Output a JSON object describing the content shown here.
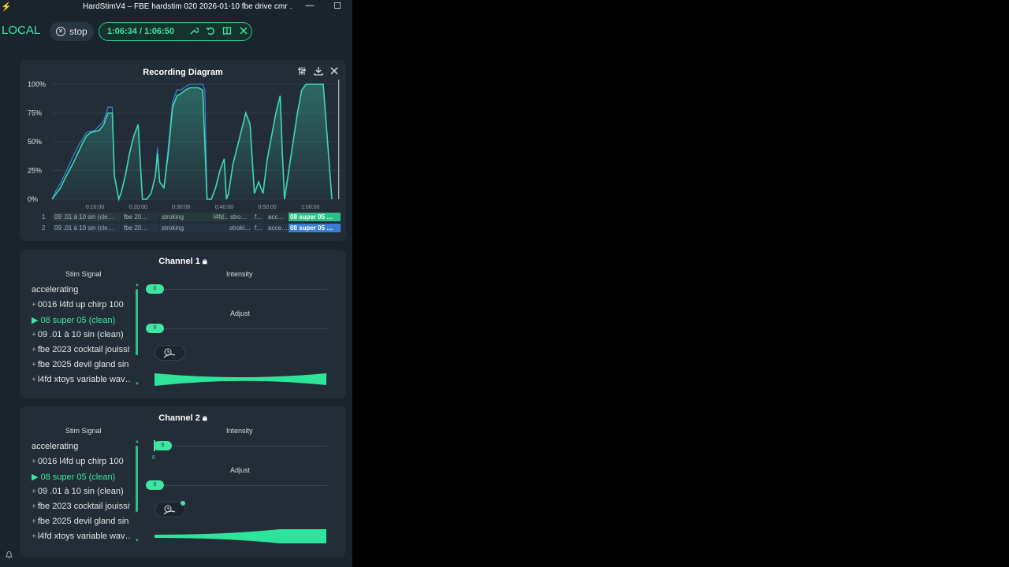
{
  "window": {
    "title": "HardStimV4 – FBE hardstim 020 2026-01-10 fbe drive cmr …",
    "minimize": "—",
    "maximize": "☐"
  },
  "topbar": {
    "mode": "LOCAL",
    "stop_label": "stop",
    "time": "1:06:34 / 1:06:50"
  },
  "diagram": {
    "title": "Recording Diagram",
    "tracks": [
      {
        "num": "1",
        "segments": [
          "09 .01 à 10  sin (cle…",
          "fbe 20…",
          "stroking",
          "l4fd…",
          "stro…",
          "f…",
          "acc…",
          "08  super  05 …"
        ]
      },
      {
        "num": "2",
        "segments": [
          "09 .01 à 10  sin (cle…",
          "fbe 20…",
          "stroking",
          "stroki…",
          "f…",
          "acce…",
          "08  super  05 …"
        ]
      }
    ]
  },
  "chart_data": {
    "type": "line",
    "title": "Recording Diagram",
    "xlabel": "",
    "ylabel": "",
    "y_ticks": [
      "100%",
      "75%",
      "50%",
      "25%",
      "0%"
    ],
    "x_ticks": [
      "0:10:00",
      "0:20:00",
      "0:30:00",
      "0:40:00",
      "0:50:00",
      "1:00:00"
    ],
    "xlim_minutes": [
      0,
      66.83
    ],
    "ylim_percent": [
      0,
      100
    ],
    "grid": true,
    "series": [
      {
        "color": "#3fd6b4",
        "points": [
          [
            0,
            0
          ],
          [
            1,
            5
          ],
          [
            2,
            10
          ],
          [
            3,
            18
          ],
          [
            4,
            25
          ],
          [
            5,
            32
          ],
          [
            6,
            40
          ],
          [
            7,
            48
          ],
          [
            8,
            55
          ],
          [
            9,
            58
          ],
          [
            11,
            60
          ],
          [
            12,
            65
          ],
          [
            13,
            75
          ],
          [
            14,
            75
          ],
          [
            14.5,
            20
          ],
          [
            15.5,
            0
          ],
          [
            16,
            5
          ],
          [
            17,
            20
          ],
          [
            18,
            40
          ],
          [
            19,
            55
          ],
          [
            20,
            65
          ],
          [
            21,
            0
          ],
          [
            22,
            0
          ],
          [
            23,
            5
          ],
          [
            24,
            20
          ],
          [
            24.5,
            40
          ],
          [
            25,
            15
          ],
          [
            26,
            10
          ],
          [
            27,
            40
          ],
          [
            28,
            80
          ],
          [
            29,
            90
          ],
          [
            30,
            92
          ],
          [
            31,
            95
          ],
          [
            32,
            97
          ],
          [
            34,
            97
          ],
          [
            35,
            95
          ],
          [
            36,
            0
          ],
          [
            37,
            0
          ],
          [
            38,
            10
          ],
          [
            39,
            25
          ],
          [
            40,
            35
          ],
          [
            40.5,
            0
          ],
          [
            41,
            5
          ],
          [
            42,
            30
          ],
          [
            43,
            45
          ],
          [
            44,
            60
          ],
          [
            45,
            75
          ],
          [
            46,
            65
          ],
          [
            47,
            5
          ],
          [
            48,
            15
          ],
          [
            49,
            5
          ],
          [
            50,
            35
          ],
          [
            51,
            55
          ],
          [
            52,
            75
          ],
          [
            53,
            90
          ],
          [
            53.5,
            40
          ],
          [
            54,
            0
          ],
          [
            55,
            25
          ],
          [
            56,
            50
          ],
          [
            57,
            75
          ],
          [
            58,
            95
          ],
          [
            59,
            100
          ],
          [
            63,
            100
          ],
          [
            64,
            50
          ],
          [
            65,
            0
          ]
        ]
      },
      {
        "color": "#3a7fd0",
        "points": [
          [
            0,
            0
          ],
          [
            1,
            8
          ],
          [
            2,
            14
          ],
          [
            3,
            22
          ],
          [
            4,
            30
          ],
          [
            5,
            38
          ],
          [
            6,
            46
          ],
          [
            7,
            52
          ],
          [
            8,
            58
          ],
          [
            10,
            60
          ],
          [
            12,
            68
          ],
          [
            13,
            80
          ],
          [
            14,
            80
          ],
          [
            14.5,
            20
          ],
          [
            15.5,
            0
          ],
          [
            16,
            5
          ],
          [
            17,
            20
          ],
          [
            18,
            40
          ],
          [
            19,
            55
          ],
          [
            20,
            65
          ],
          [
            21,
            0
          ],
          [
            22,
            0
          ],
          [
            23,
            5
          ],
          [
            24,
            20
          ],
          [
            24.5,
            45
          ],
          [
            25,
            15
          ],
          [
            26,
            10
          ],
          [
            27,
            45
          ],
          [
            28,
            85
          ],
          [
            29,
            95
          ],
          [
            30,
            95
          ],
          [
            31,
            98
          ],
          [
            32,
            100
          ],
          [
            35,
            100
          ],
          [
            35.5,
            95
          ],
          [
            36,
            0
          ],
          [
            37,
            0
          ],
          [
            38,
            10
          ],
          [
            39,
            25
          ],
          [
            40,
            35
          ],
          [
            40.5,
            0
          ],
          [
            41,
            5
          ],
          [
            42,
            30
          ],
          [
            43,
            45
          ],
          [
            44,
            60
          ],
          [
            45,
            75
          ],
          [
            46,
            65
          ],
          [
            47,
            5
          ],
          [
            48,
            15
          ],
          [
            49,
            5
          ],
          [
            50,
            35
          ],
          [
            51,
            55
          ],
          [
            52,
            75
          ],
          [
            53,
            90
          ],
          [
            53.5,
            40
          ],
          [
            54,
            0
          ],
          [
            55,
            25
          ],
          [
            56,
            50
          ],
          [
            57,
            75
          ],
          [
            58,
            95
          ],
          [
            59,
            100
          ],
          [
            63,
            100
          ],
          [
            64,
            50
          ],
          [
            65,
            0
          ]
        ]
      }
    ]
  },
  "channels": [
    {
      "title": "Channel 1",
      "stim_header": "Stim Signal",
      "intensity_header": "Intensity",
      "adjust_label": "Adjust",
      "signals": [
        {
          "label": "accelerating",
          "prefix": "",
          "active": false
        },
        {
          "label": "0016 l4fd up chirp 100",
          "prefix": "+",
          "active": false
        },
        {
          "label": "08 super 05 (clean)",
          "prefix": "▶",
          "active": true
        },
        {
          "label": "09 .01 à 10 sin (clean)",
          "prefix": "+",
          "active": false
        },
        {
          "label": "fbe 2023 cocktail jouissif",
          "prefix": "+",
          "active": false
        },
        {
          "label": "fbe 2025 devil gland sin",
          "prefix": "+",
          "active": false
        },
        {
          "label": "l4fd xtoys variable wav…",
          "prefix": "+",
          "active": false
        }
      ],
      "intensity_value": "0",
      "adjust_value": "0",
      "intensity_fraction": 0.0
    },
    {
      "title": "Channel 2",
      "stim_header": "Stim Signal",
      "intensity_header": "Intensity",
      "adjust_label": "Adjust",
      "signals": [
        {
          "label": "accelerating",
          "prefix": "",
          "active": false
        },
        {
          "label": "0016 l4fd up chirp 100",
          "prefix": "+",
          "active": false
        },
        {
          "label": "08 super 05 (clean)",
          "prefix": "▶",
          "active": true
        },
        {
          "label": "09 .01 à 10 sin (clean)",
          "prefix": "+",
          "active": false
        },
        {
          "label": "fbe 2023 cocktail jouissif",
          "prefix": "+",
          "active": false
        },
        {
          "label": "fbe 2025 devil gland sin",
          "prefix": "+",
          "active": false
        },
        {
          "label": "l4fd xtoys variable wav…",
          "prefix": "+",
          "active": false
        }
      ],
      "intensity_value": "5",
      "intensity_min_label": "0",
      "adjust_value": "0",
      "intensity_fraction": 0.05
    }
  ],
  "colors": {
    "accent": "#3ee6a2",
    "series1": "#3fd6b4",
    "series2": "#3a7fd0",
    "panel": "#222d37",
    "background": "#1a242d"
  }
}
